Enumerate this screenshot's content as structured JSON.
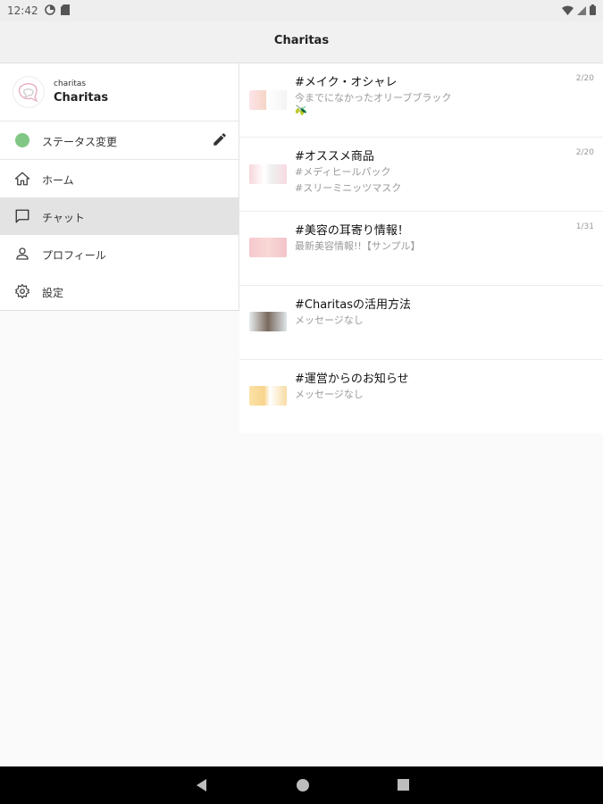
{
  "status_bar": {
    "time": "12:42"
  },
  "app_bar": {
    "title": "Charitas"
  },
  "drawer": {
    "profile": {
      "subtitle": "charitas",
      "name": "Charitas"
    },
    "status": {
      "label": "ステータス変更",
      "dot_color": "#81c784"
    },
    "items": [
      {
        "label": "ホーム",
        "icon": "home-icon"
      },
      {
        "label": "チャット",
        "icon": "chat-icon"
      },
      {
        "label": "プロフィール",
        "icon": "person-icon"
      },
      {
        "label": "設定",
        "icon": "gear-icon"
      }
    ]
  },
  "chats": [
    {
      "title": "#メイク・オシャレ",
      "lines": [
        "今までになかったオリーブブラック",
        "🫒"
      ],
      "date": "2/20"
    },
    {
      "title": "#オススメ商品",
      "lines": [
        "#メディヒールパック",
        "#スリーミニッツマスク"
      ],
      "date": "2/20"
    },
    {
      "title": "#美容の耳寄り情報！",
      "lines": [
        "最新美容情報!!【サンプル】"
      ],
      "date": "1/31"
    },
    {
      "title": "#Charitasの活用方法",
      "lines": [
        "メッセージなし"
      ],
      "date": ""
    },
    {
      "title": "#運営からのお知らせ",
      "lines": [
        "メッセージなし"
      ],
      "date": ""
    }
  ]
}
